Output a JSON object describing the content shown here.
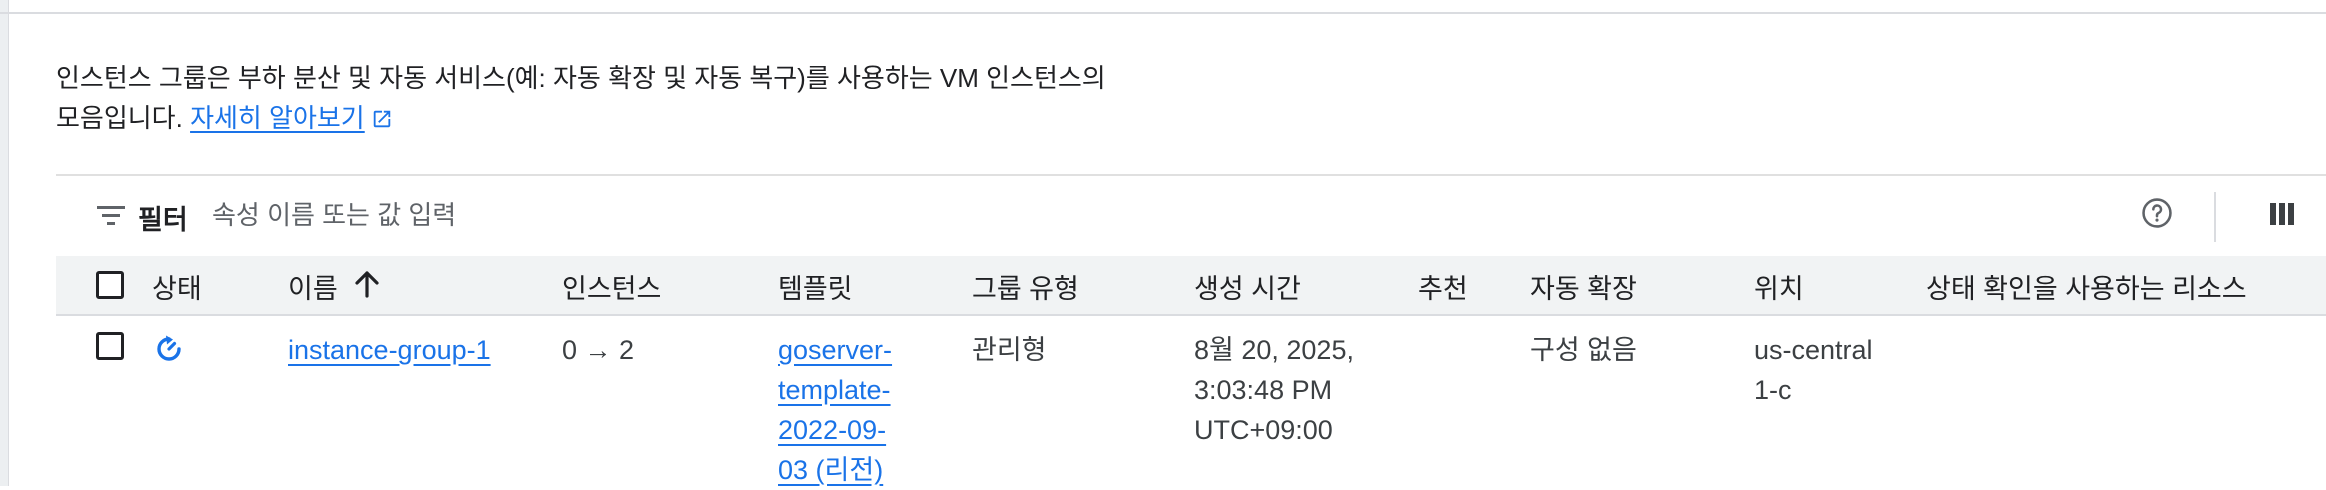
{
  "description": {
    "text": "인스턴스 그룹은 부하 분산 및 자동 서비스(예: 자동 확장 및 자동 복구)를 사용하는 VM 인스턴스의 모음입니다.",
    "link_label": "자세히 알아보기",
    "link_icon": "open-in-new-icon"
  },
  "filter": {
    "label": "필터",
    "placeholder": "속성 이름 또는 값 입력",
    "icon": "filter-icon"
  },
  "toolbar": {
    "help_icon": "help-icon",
    "column_display_icon": "column-display-icon"
  },
  "table": {
    "columns": {
      "status": "상태",
      "name": "이름",
      "instances": "인스턴스",
      "template": "템플릿",
      "group_type": "그룹 유형",
      "created": "생성 시간",
      "recommendation": "추천",
      "autoscaling": "자동 확장",
      "location": "위치",
      "in_use_by": "상태 확인을 사용하는 리소스"
    },
    "sort": {
      "column": "name",
      "direction": "ascending",
      "icon": "arrow-up-icon"
    },
    "rows": [
      {
        "status_icon": "updating-icon",
        "name": "instance-group-1",
        "instances": "0 → 2",
        "template": "goserver-template-2022-09-03 (리전)",
        "group_type": "관리형",
        "created": "8월 20, 2025, 3:03:48 PM UTC+09:00",
        "recommendation": "",
        "autoscaling": "구성 없음",
        "location": "us-central1-c",
        "in_use_by": ""
      }
    ]
  },
  "colors": {
    "link": "#1a73e8",
    "header_bg": "#f1f3f4",
    "divider": "#dadce0",
    "text": "#202124"
  }
}
